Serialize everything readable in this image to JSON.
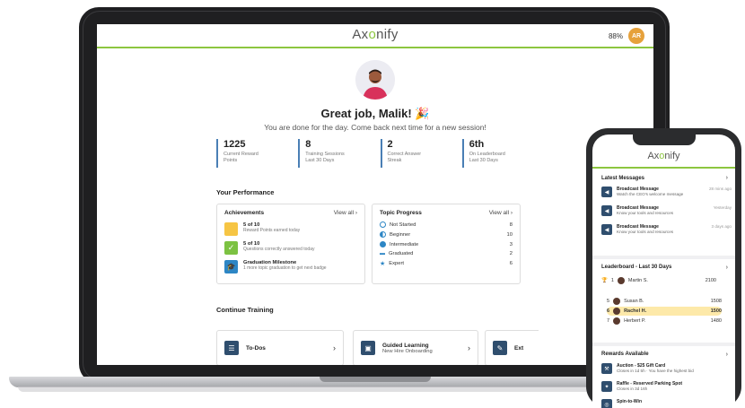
{
  "laptop": {
    "brand": {
      "before": "Ax",
      "q": "o",
      "after": "nify"
    },
    "battery": "88%",
    "user_initials": "AR",
    "greeting": "Great job, Malik! 🎉",
    "subtitle": "You are done for the day. Come back next time for a new session!",
    "stats": [
      {
        "value": "1225",
        "label1": "Current Reward",
        "label2": "Points"
      },
      {
        "value": "8",
        "label1": "Training Sessions",
        "label2": "Last 30 Days"
      },
      {
        "value": "2",
        "label1": "Correct Answer",
        "label2": "Streak"
      },
      {
        "value": "6th",
        "label1": "On Leaderboard",
        "label2": "Last 30 Days"
      }
    ],
    "performance_title": "Your Performance",
    "achievements": {
      "title": "Achievements",
      "view_all": "View all",
      "items": [
        {
          "title": "5 of 10",
          "desc": "Reward Points earned today",
          "color": "#f6c544"
        },
        {
          "title": "5 of 10",
          "desc": "Questions correctly answered today",
          "color": "#7cc242"
        },
        {
          "title": "Graduation Milestone",
          "desc": "1 more topic graduation to get next badge",
          "color": "#2d86c5"
        }
      ]
    },
    "topic_progress": {
      "title": "Topic Progress",
      "view_all": "View all",
      "items": [
        {
          "label": "Not Started",
          "count": "8"
        },
        {
          "label": "Beginner",
          "count": "10"
        },
        {
          "label": "Intermediate",
          "count": "3"
        },
        {
          "label": "Graduated",
          "count": "2"
        },
        {
          "label": "Expert",
          "count": "6"
        }
      ]
    },
    "continue_title": "Continue Training",
    "training": [
      {
        "title": "To-Dos",
        "sub": ""
      },
      {
        "title": "Guided Learning",
        "sub": "New Hire Onboarding"
      },
      {
        "title": "Ext",
        "sub": ""
      }
    ]
  },
  "phone": {
    "brand": {
      "before": "Ax",
      "q": "o",
      "after": "nify"
    },
    "messages_title": "Latest Messages",
    "messages": [
      {
        "title": "Broadcast Message",
        "desc": "Watch the CEO's welcome message",
        "time": "28 mins ago"
      },
      {
        "title": "Broadcast Message",
        "desc": "Know your tools and resources",
        "time": "Yesterday"
      },
      {
        "title": "Broadcast Message",
        "desc": "Know your tools and resources",
        "time": "3 days ago"
      }
    ],
    "leaderboard_title": "Leaderboard - Last 30 Days",
    "leaderboard": [
      {
        "rank": "1",
        "name": "Martin S.",
        "points": "2100"
      },
      {
        "rank": "5",
        "name": "Susan B.",
        "points": "1508"
      },
      {
        "rank": "6",
        "name": "Rachel H.",
        "points": "1500"
      },
      {
        "rank": "7",
        "name": "Herbert P.",
        "points": "1480"
      }
    ],
    "rewards_title": "Rewards Available",
    "rewards": [
      {
        "title": "Auction - $25 Gift Card",
        "desc": "Closes in 1d 5h · You have the highest bid"
      },
      {
        "title": "Raffle - Reserved Parking Spot",
        "desc": "Closes in 3d 16h"
      },
      {
        "title": "Spin-to-Win",
        "desc": ""
      }
    ]
  }
}
